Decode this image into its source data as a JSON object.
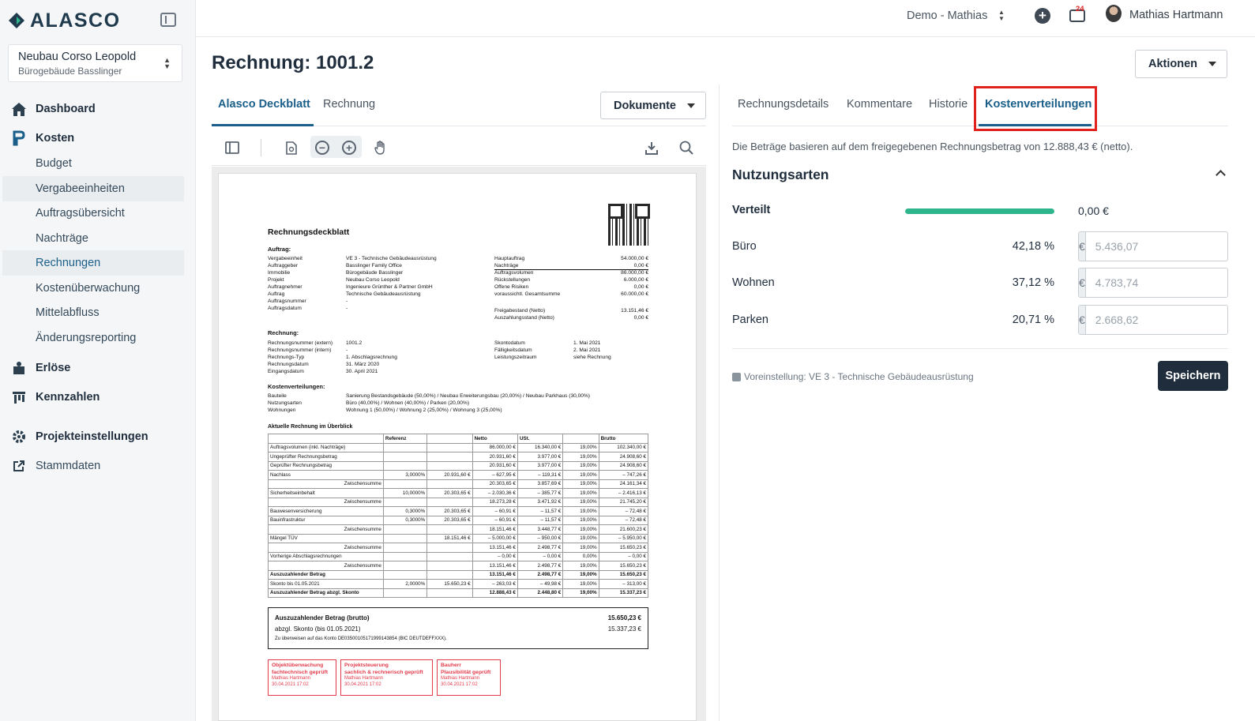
{
  "brand": {
    "name": "ALASCO"
  },
  "project": {
    "name": "Neubau Corso Leopold",
    "sub": "Bürogebäude Basslinger"
  },
  "nav": {
    "dashboard": "Dashboard",
    "kosten": "Kosten",
    "budget": "Budget",
    "vergabe": "Vergabeeinheiten",
    "auftrag": "Auftragsübersicht",
    "nachtraege": "Nachträge",
    "rechnungen": "Rechnungen",
    "kostenueb": "Kostenüberwachung",
    "mittel": "Mittelabfluss",
    "aenderung": "Änderungsreporting",
    "erloese": "Erlöse",
    "kennzahlen": "Kennzahlen",
    "projekteinst": "Projekteinstellungen",
    "stammdaten": "Stammdaten"
  },
  "header": {
    "tenant": "Demo - Mathias",
    "badge": "24",
    "user": "Mathias Hartmann"
  },
  "page": {
    "title": "Rechnung: 1001.2",
    "actions": "Aktionen",
    "documents": "Dokumente"
  },
  "left_tabs": [
    "Alasco Deckblatt",
    "Rechnung"
  ],
  "right_tabs": [
    "Rechnungsdetails",
    "Kommentare",
    "Historie",
    "Kostenverteilungen"
  ],
  "panel": {
    "info": "Die Beträge basieren auf dem freigegebenen Rechnungsbetrag von 12.888,43 € (netto).",
    "section": "Nutzungsarten",
    "distributed_label": "Verteilt",
    "distributed_fraction": 1.0,
    "distributed_value": "0,00 €",
    "currency": "€",
    "rows": [
      {
        "label": "Büro",
        "pct": "42,18 %",
        "value": "5.436,07"
      },
      {
        "label": "Wohnen",
        "pct": "37,12 %",
        "value": "4.783,74"
      },
      {
        "label": "Parken",
        "pct": "20,71 %",
        "value": "2.668,62"
      }
    ],
    "preset": "Voreinstellung: VE 3 - Technische Gebäudeausrüstung",
    "save": "Speichern"
  },
  "doc": {
    "title": "Rechnungsdeckblatt",
    "auftrag_h": "Auftrag:",
    "auftrag_labels": "Vergabeeinheit\nAuftraggeber\nImmobilie\nProjekt\nAuftragnehmer\nAuftrag\nAuftragsnummer\nAuftragsdatum",
    "auftrag_values": "VE 3 - Technische Gebäudeausrüstung\nBasslinger Family Office\nBürogebäude Basslinger\nNeubau Corso Leopold\nIngenieure Grünther & Partner GmbH\nTechnische Gebäudeausrüstung\n-\n-",
    "sum_labels": "Hauptauftrag\nNachträge\nAuftragsvolumen\nRückstellungen\nOffene Risiken\nvoraussichtl. Gesamtsumme",
    "sum_values": "54.000,00 €\n0,00 €\n86.000,00 €\n6.000,00 €\n0,00 €\n60.000,00 €",
    "frei_labels": "Freigabestand (Netto)\nAuszahlungsstand (Netto)",
    "frei_values": "13.151,46 €\n0,00 €",
    "rechnung_h": "Rechnung:",
    "rechnung_labels": "Rechnungsnummer (extern)\nRechnungsnummer (intern)\nRechnungs-Typ\nRechnungsdatum\nEingangsdatum",
    "rechnung_values": "1001.2\n-\n1. Abschlagsrechnung\n31. März 2020\n30. April 2021",
    "skonto_labels": "Skontodatum\nFälligkeitsdatum\nLeistungszeitraum",
    "skonto_values": "1. Mai 2021\n2. Mai 2021\nsiehe Rechnung",
    "kv_h": "Kostenverteilungen:",
    "kv_labels": "Bauteile\nNutzungsarten\nWohnungen",
    "kv_values": "Sanierung Bestandsgebäude (50,00%) / Neubau Erweiterungsbau (20,00%) / Neubau Parkhaus (30,00%)\nBüro (40,00%) / Wohnen (40,00%) / Parken (20,00%)\nWohnung 1 (50,00%) / Wohnung 2 (25,00%) / Wohnung 3 (25,00%)",
    "table_h": "Aktuelle Rechnung im Überblick",
    "table_head": [
      "",
      "Referenz",
      "",
      "Netto",
      "USt.",
      "",
      "Brutto"
    ],
    "table_rows": [
      [
        "Auftragsvolumen (inkl. Nachträge)",
        "",
        "",
        "86.000,00 €",
        "16.340,00 €",
        "19,00%",
        "102.340,00 €"
      ],
      [
        "Ungeprüfter Rechnungsbetrag",
        "",
        "",
        "20.931,60 €",
        "3.977,00 €",
        "19,00%",
        "24.908,60 €"
      ],
      [
        "Geprüfter Rechnungsbetrag",
        "",
        "",
        "20.931,60 €",
        "3.977,00 €",
        "19,00%",
        "24.908,60 €"
      ],
      [
        "Nachlass",
        "3,0000%",
        "20.931,60 €",
        "– 627,95 €",
        "– 119,31 €",
        "19,00%",
        "– 747,26 €"
      ],
      [
        "Zwischensumme",
        "",
        "",
        "20.303,65 €",
        "3.857,69 €",
        "19,00%",
        "24.161,34 €"
      ],
      [
        "Sicherheitseinbehalt",
        "10,0000%",
        "20.303,65 €",
        "– 2.030,36 €",
        "– 385,77 €",
        "19,00%",
        "– 2.416,13 €"
      ],
      [
        "Zwischensumme",
        "",
        "",
        "18.273,28 €",
        "3.471,92 €",
        "19,00%",
        "21.745,20 €"
      ],
      [
        "Bauwesenversicherung",
        "0,3000%",
        "20.303,65 €",
        "– 60,91 €",
        "– 11,57 €",
        "19,00%",
        "– 72,48 €"
      ],
      [
        "Bauinfrastruktur",
        "0,3000%",
        "20.303,65 €",
        "– 60,91 €",
        "– 11,57 €",
        "19,00%",
        "– 72,48 €"
      ],
      [
        "Zwischensumme",
        "",
        "",
        "18.151,46 €",
        "3.448,77 €",
        "19,00%",
        "21.600,23 €"
      ],
      [
        "Mängel TÜV",
        "",
        "18.151,46 €",
        "– 5.000,00 €",
        "– 950,00 €",
        "19,00%",
        "– 5.950,00 €"
      ],
      [
        "Zwischensumme",
        "",
        "",
        "13.151,46 €",
        "2.498,77 €",
        "19,00%",
        "15.650,23 €"
      ],
      [
        "Vorherige Abschlagsrechnungen",
        "",
        "",
        "– 0,00 €",
        "– 0,00 €",
        "0,00%",
        "– 0,00 €"
      ],
      [
        "Zwischensumme",
        "",
        "",
        "13.151,46 €",
        "2.498,77 €",
        "19,00%",
        "15.650,23 €"
      ],
      [
        "Auszuzahlender Betrag",
        "",
        "",
        "13.151,46 €",
        "2.498,77 €",
        "19,00%",
        "15.650,23 €"
      ],
      [
        "Skonto bis 01.05.2021",
        "2,0000%",
        "15.650,23 €",
        "– 263,03 €",
        "– 49,98 €",
        "19,00%",
        "– 313,00 €"
      ],
      [
        "Auszuzahlender Betrag abzgl. Skonto",
        "",
        "",
        "12.888,43 €",
        "2.448,80 €",
        "19,00%",
        "15.337,23 €"
      ]
    ],
    "summary_l1": "Auszuzahlender Betrag (brutto)",
    "summary_v1": "15.650,23 €",
    "summary_l2": "abzgl. Skonto (bis 01.05.2021)",
    "summary_v2": "15.337,23 €",
    "summary_note": "Zu überweisen auf das Konto DE03500105171999143854 (BIC DEUTDEFFXXX).",
    "stamps": [
      {
        "title": "Objektüberwachung\nfachtechnisch geprüft",
        "name": "Mathias Hartmann\n30.04.2021 17:02"
      },
      {
        "title": "Projektsteuerung\nsachlich & rechnerisch geprüft",
        "name": "Mathias Hartmann\n30.04.2021 17:02"
      },
      {
        "title": "Bauherr\nPlausibilität geprüft",
        "name": "Mathias Hartmann\n30.04.2021 17:02"
      }
    ]
  }
}
